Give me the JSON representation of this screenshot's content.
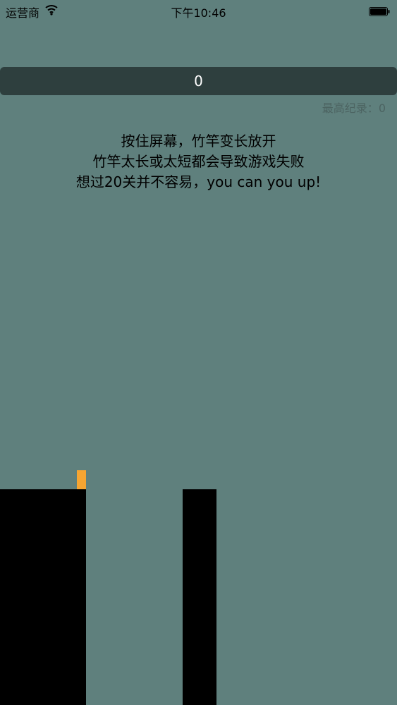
{
  "status_bar": {
    "carrier": "运营商",
    "time": "下午10:46"
  },
  "game": {
    "score": "0",
    "best_label": "最高纪录：",
    "best_value": "0",
    "instructions": [
      "按住屏幕，竹竿变长放开",
      "竹竿太长或太短都会导致游戏失败",
      "想过20关并不容易，you can you up!"
    ],
    "colors": {
      "background": "#5f807d",
      "score_bar": "#2e3f3e",
      "hero": "#f6a532",
      "pillar": "#000000"
    }
  },
  "icons": {
    "wifi": "wifi-icon",
    "battery": "battery-icon"
  }
}
